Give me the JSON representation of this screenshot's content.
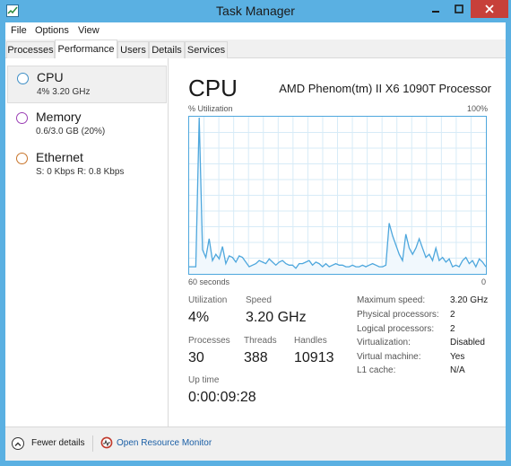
{
  "window": {
    "title": "Task Manager",
    "colors": {
      "frame": "#5ab0e2",
      "close": "#c7403a",
      "graph_line": "#4ea7dd",
      "graph_fill": "#f1f8fd",
      "link": "#1b5fa6"
    }
  },
  "menu": {
    "items": [
      "File",
      "Options",
      "View"
    ]
  },
  "tabs": [
    "Processes",
    "Performance",
    "Users",
    "Details",
    "Services"
  ],
  "active_tab": "Performance",
  "sidebar": {
    "items": [
      {
        "title": "CPU",
        "subtitle": "4% 3.20 GHz",
        "ring_color": "#3e8fc6",
        "selected": true
      },
      {
        "title": "Memory",
        "subtitle": "0.6/3.0 GB (20%)",
        "ring_color": "#9b3fb5",
        "selected": false
      },
      {
        "title": "Ethernet",
        "subtitle": "S: 0 Kbps R: 0.8 Kbps",
        "ring_color": "#c8742a",
        "selected": false
      }
    ]
  },
  "main": {
    "title": "CPU",
    "processor": "AMD Phenom(tm) II X6 1090T Processor",
    "graph": {
      "ylabel": "% Utilization",
      "ymax_label": "100%",
      "xstart_label": "60 seconds",
      "xend_label": "0"
    },
    "stats": {
      "utilization_label": "Utilization",
      "utilization": "4%",
      "speed_label": "Speed",
      "speed": "3.20 GHz",
      "processes_label": "Processes",
      "processes": "30",
      "threads_label": "Threads",
      "threads": "388",
      "handles_label": "Handles",
      "handles": "10913",
      "uptime_label": "Up time",
      "uptime": "0:00:09:28"
    },
    "specs": [
      {
        "label": "Maximum speed:",
        "value": "3.20 GHz"
      },
      {
        "label": "Physical processors:",
        "value": "2"
      },
      {
        "label": "Logical processors:",
        "value": "2"
      },
      {
        "label": "Virtualization:",
        "value": "Disabled"
      },
      {
        "label": "Virtual machine:",
        "value": "Yes"
      },
      {
        "label": "L1 cache:",
        "value": "N/A"
      }
    ]
  },
  "cpu_history": {
    "x_range_seconds": [
      60,
      0
    ],
    "y_range_percent": [
      0,
      100
    ],
    "values": [
      4,
      4,
      4,
      100,
      15,
      10,
      22,
      8,
      12,
      9,
      17,
      6,
      11,
      10,
      7,
      11,
      10,
      7,
      4,
      5,
      6,
      8,
      7,
      6,
      9,
      7,
      5,
      7,
      8,
      6,
      5,
      5,
      3,
      6,
      6,
      7,
      8,
      5,
      7,
      6,
      4,
      6,
      4,
      5,
      6,
      5,
      5,
      4,
      4,
      5,
      4,
      4,
      5,
      4,
      5,
      6,
      5,
      4,
      4,
      5,
      32,
      24,
      18,
      12,
      8,
      25,
      16,
      12,
      16,
      22,
      16,
      10,
      12,
      8,
      16,
      8,
      10,
      7,
      9,
      4,
      5,
      4,
      8,
      10,
      6,
      8,
      4,
      9,
      7,
      4
    ]
  },
  "footer": {
    "fewer_details": "Fewer details",
    "open_resource_monitor": "Open Resource Monitor"
  }
}
